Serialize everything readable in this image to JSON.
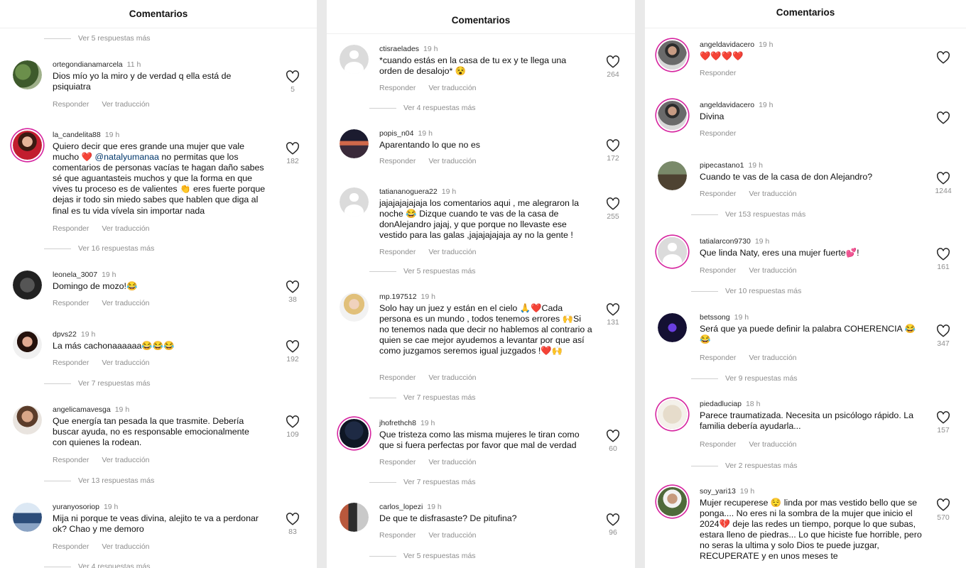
{
  "panels": [
    {
      "title": "Comentarios",
      "comments": [
        {
          "username": "ortegondianamarcela",
          "time": "11 h",
          "text": "Dios  mío yo la miro y de verdad q ella está de psiquiatra",
          "likes": "5",
          "reply": "Responder",
          "translate": "Ver traducción"
        },
        {
          "username": "la_candelita88",
          "time": "19 h",
          "text_parts": [
            "Quiero decir que eres grande una mujer que vale mucho ❤️ ",
            "@natalyumanaa",
            " no permitas que los comentarios de personas vacías te hagan daño sabes sé que aguantasteis muchos y que la forma en que vives tu proceso es de valientes 👏 eres fuerte porque dejas ir todo sin miedo sabes que hablen que diga al final es tu vida vívela sin importar nada"
          ],
          "likes": "182",
          "reply": "Responder",
          "translate": "Ver traducción"
        },
        {
          "username": "leonela_3007",
          "time": "19 h",
          "text": "Domingo de mozo!😂",
          "likes": "38",
          "reply": "Responder",
          "translate": "Ver traducción"
        },
        {
          "username": "dpvs22",
          "time": "19 h",
          "text": "La más cachonaaaaaa😂😂😂",
          "likes": "192",
          "reply": "Responder",
          "translate": "Ver traducción"
        },
        {
          "username": "angelicamavesga",
          "time": "19 h",
          "text": "Que energía tan pesada la que trasmite. Debería buscar ayuda, no es responsable emocionalmente con quienes la rodean.",
          "likes": "109",
          "reply": "Responder",
          "translate": "Ver traducción"
        },
        {
          "username": "yuranyosoriop",
          "time": "19 h",
          "text": "Mija ni porque te veas divina, alejito te va a perdonar ok? Chao y me demoro",
          "likes": "83",
          "reply": "Responder",
          "translate": "Ver traducción"
        }
      ],
      "replies": [
        "Ver 5 respuestas más",
        "Ver 16 respuestas más",
        "Ver 7 respuestas más",
        "Ver 13 respuestas más",
        "Ver 4 respuestas más"
      ]
    },
    {
      "title": "Comentarios",
      "comments": [
        {
          "username": "ctisraelades",
          "time": "19 h",
          "text": "*cuando estás en la casa de tu ex y te llega una orden de desalojo* 😵",
          "likes": "264",
          "reply": "Responder",
          "translate": "Ver traducción"
        },
        {
          "username": "popis_n04",
          "time": "19 h",
          "text": "Aparentando lo que no es",
          "likes": "172",
          "reply": "Responder",
          "translate": "Ver traducción"
        },
        {
          "username": "tatiananoguera22",
          "time": "19 h",
          "text": "jajajajajajaja los comentarios aqui , me alegraron la noche 😂 Dizque cuando te vas de la casa de donAlejandro jajaj, y que porque no llevaste ese vestido para las galas ,jajajajajaja ay no la gente !",
          "likes": "255",
          "reply": "Responder",
          "translate": "Ver traducción"
        },
        {
          "username": "mp.197512",
          "time": "19 h",
          "text": "Solo hay un juez y están en el cielo 🙏❤️Cada persona es un mundo , todos tenemos errores 🙌Si no tenemos nada que decir no hablemos al contrario a quien se cae mejor ayudemos a levantar por que así como juzgamos seremos igual juzgados !❤️🙌",
          "likes": "131",
          "reply": "Responder",
          "translate": "Ver traducción"
        },
        {
          "username": "jhofrethch8",
          "time": "19 h",
          "text": "Que tristeza como las misma mujeres le tiran como que si fuera perfectas por favor que mal de verdad",
          "likes": "60",
          "reply": "Responder",
          "translate": "Ver traducción"
        },
        {
          "username": "carlos_lopezi",
          "time": "19 h",
          "text": "De que te disfrasaste? De pitufina?",
          "likes": "96",
          "reply": "Responder",
          "translate": "Ver traducción"
        }
      ],
      "replies": [
        "Ver 4 respuestas más",
        "Ver 5 respuestas más",
        "Ver 7 respuestas más",
        "Ver 7 respuestas más",
        "Ver 5 respuestas más"
      ]
    },
    {
      "title": "Comentarios",
      "comments": [
        {
          "username": "angeldavidacero",
          "time": "19 h",
          "text": "❤️❤️❤️❤️",
          "likes": "",
          "reply": "Responder",
          "translate": ""
        },
        {
          "username": "angeldavidacero",
          "time": "19 h",
          "text": "Divina",
          "likes": "",
          "reply": "Responder",
          "translate": ""
        },
        {
          "username": "pipecastano1",
          "time": "19 h",
          "text": "Cuando te vas de la casa de don Alejandro?",
          "likes": "1244",
          "reply": "Responder",
          "translate": "Ver traducción"
        },
        {
          "username": "tatialarcon9730",
          "time": "19 h",
          "text": "Que linda Naty, eres una mujer fuerte💕!",
          "likes": "161",
          "reply": "Responder",
          "translate": "Ver traducción"
        },
        {
          "username": "betssong",
          "time": "19 h",
          "text": "Será que ya puede definir la palabra COHERENCIA 😂😂",
          "likes": "347",
          "reply": "Responder",
          "translate": "Ver traducción"
        },
        {
          "username": "piedadluciap",
          "time": "18 h",
          "text": "Parece traumatizada. Necesita un psicólogo rápido. La familia debería ayudarla...",
          "likes": "157",
          "reply": "Responder",
          "translate": "Ver traducción"
        },
        {
          "username": "soy_yari13",
          "time": "19 h",
          "text": "Mujer recuperese 😌 linda por mas vestido bello que se ponga.... No eres ni la sombra de la mujer que inicio el 2024💔 deje las redes un tiempo, porque lo que subas, estara lleno de piedras... Lo que hiciste fue horrible,  pero no seras la ultima y solo Dios te puede juzgar, RECUPERATE y en unos meses te",
          "likes": "570",
          "reply": "",
          "translate": ""
        }
      ],
      "replies": [
        "Ver 153 respuestas más",
        "Ver 10 respuestas más",
        "Ver 9 respuestas más",
        "Ver 2 respuestas más"
      ]
    }
  ],
  "icons": {
    "like": "heart-outline-icon",
    "avatar_placeholder": "default-avatar-icon"
  },
  "colors": {
    "story_ring": "#d6249f",
    "secondary_text": "#8e8e8e",
    "mention": "#00376b"
  }
}
